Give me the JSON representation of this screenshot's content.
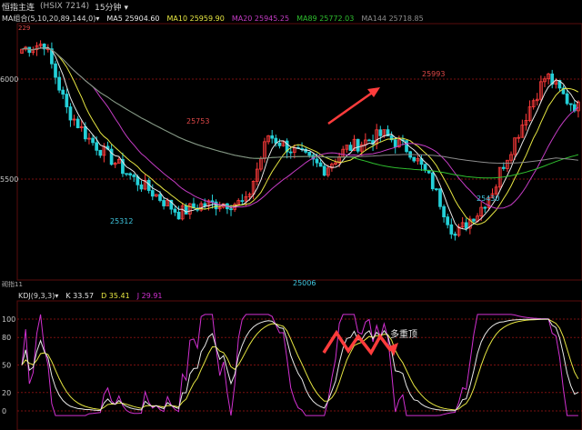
{
  "title": {
    "instrument": "恒指主连",
    "code": "(HSIX 7214)",
    "period": "15分钟",
    "period_dropdown_icon": "chevron-down-icon"
  },
  "ma_legend": {
    "group_label": "MA组合(5,10,20,89,144,0)",
    "items": [
      {
        "label": "MA5 25904.60",
        "color": "#e8e8e8"
      },
      {
        "label": "MA10 25959.90",
        "color": "#e6e642"
      },
      {
        "label": "MA20 25945.25",
        "color": "#c43cc4"
      },
      {
        "label": "MA89 25772.03",
        "color": "#2fbf2f"
      },
      {
        "label": "MA144 25718.85",
        "color": "#8c8c8c"
      }
    ]
  },
  "price_axis": {
    "labels": [
      "6000",
      "5500"
    ],
    "top_value_label": "229"
  },
  "price_annotations": [
    {
      "text": "25753",
      "color": "#e04848"
    },
    {
      "text": "25993",
      "color": "#e04848"
    },
    {
      "text": "25312",
      "color": "#3fc7e0"
    },
    {
      "text": "25006",
      "color": "#3fc7e0"
    },
    {
      "text": "25430",
      "color": "#3fc7e0"
    }
  ],
  "indicator_panel_label": "砌指11",
  "kdj_legend": {
    "group_label": "KDJ(9,3,3)",
    "items": [
      {
        "label": "K 33.57",
        "color": "#e8e8e8"
      },
      {
        "label": "D 35.41",
        "color": "#e6e642"
      },
      {
        "label": "J 29.91",
        "color": "#d030d0"
      }
    ]
  },
  "kdj_axis": {
    "labels": [
      "100",
      "80",
      "50",
      "20",
      "0"
    ]
  },
  "kdj_annotation": "多重顶",
  "colors": {
    "up_candle": "#ff3b3b",
    "down_candle": "#24d0d8",
    "grid": "#7a1010",
    "arrow": "#ff3c3c"
  },
  "chart_data": {
    "type": "candlestick",
    "price_axis_ticks": [
      26000,
      25500
    ],
    "marked_highs": [
      25753,
      25993
    ],
    "marked_lows": [
      25312,
      25006,
      25430
    ],
    "moving_averages": {
      "MA5": 25904.6,
      "MA10": 25959.9,
      "MA20": 25945.25,
      "MA89": 25772.03,
      "MA144": 25718.85
    },
    "kdj": {
      "K": 33.57,
      "D": 35.41,
      "J": 29.91,
      "axis_ticks": [
        100,
        80,
        50,
        20,
        0
      ]
    }
  }
}
